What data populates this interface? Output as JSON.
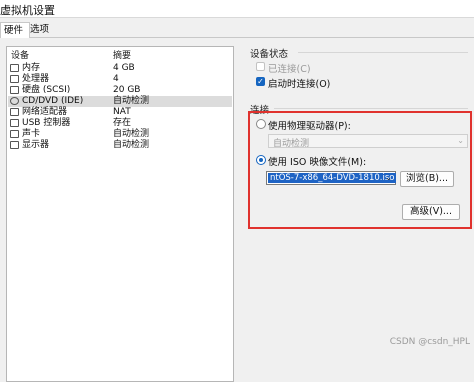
{
  "window": {
    "title": "虚拟机设置"
  },
  "tabs": [
    {
      "label": "硬件"
    },
    {
      "label": "选项"
    }
  ],
  "device_list": {
    "headers": {
      "device": "设备",
      "summary": "摘要"
    },
    "rows": [
      {
        "name": "内存",
        "summary": "4 GB",
        "icon": "memory-icon",
        "selected": false
      },
      {
        "name": "处理器",
        "summary": "4",
        "icon": "processor-icon",
        "selected": false
      },
      {
        "name": "硬盘 (SCSI)",
        "summary": "20 GB",
        "icon": "hard-disk-icon",
        "selected": false
      },
      {
        "name": "CD/DVD (IDE)",
        "summary": "自动检测",
        "icon": "cd-dvd-icon",
        "selected": true
      },
      {
        "name": "网络适配器",
        "summary": "NAT",
        "icon": "network-adapter-icon",
        "selected": false
      },
      {
        "name": "USB 控制器",
        "summary": "存在",
        "icon": "usb-icon",
        "selected": false
      },
      {
        "name": "声卡",
        "summary": "自动检测",
        "icon": "sound-card-icon",
        "selected": false
      },
      {
        "name": "显示器",
        "summary": "自动检测",
        "icon": "display-icon",
        "selected": false
      }
    ]
  },
  "device_status": {
    "label": "设备状态",
    "connected": {
      "label": "已连接(C)",
      "checked": false,
      "enabled": false
    },
    "connect_at_power_on": {
      "label": "启动时连接(O)",
      "checked": true,
      "enabled": true
    }
  },
  "connection": {
    "label": "连接",
    "physical_drive": {
      "label": "使用物理驱动器(P):",
      "selected": false,
      "dropdown_value": "自动检测"
    },
    "iso_image": {
      "label": "使用 ISO 映像文件(M):",
      "selected": true,
      "path": "ntOS-7-x86_64-DVD-1810.iso",
      "browse_label": "浏览(B)..."
    },
    "advanced_label": "高级(V)..."
  },
  "watermark": "CSDN @csdn_HPL",
  "colors": {
    "accent": "#1565c0",
    "highlight_border": "#e0322e",
    "selection": "#1e63c4"
  }
}
